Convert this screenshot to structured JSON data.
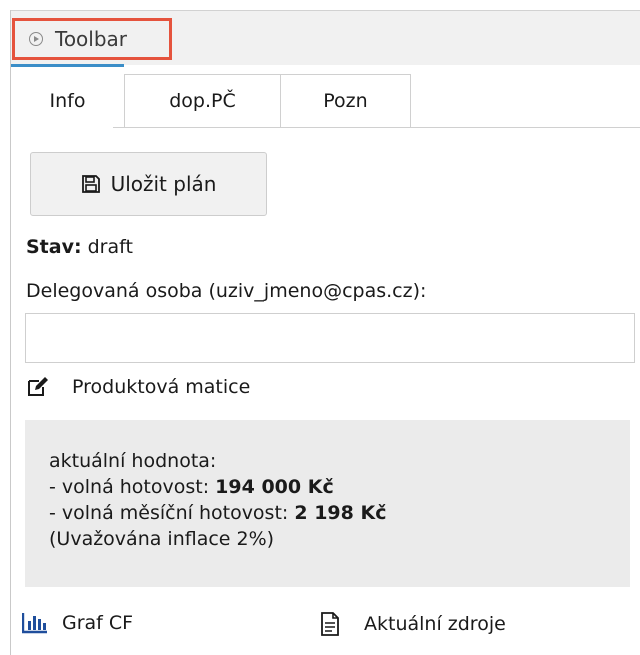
{
  "toolbar": {
    "label": "Toolbar",
    "icon": "play-circle-icon"
  },
  "tabs": [
    {
      "label": "Info",
      "active": true
    },
    {
      "label": "dop.PČ",
      "active": false
    },
    {
      "label": "Pozn",
      "active": false
    }
  ],
  "save_button": {
    "label": "Uložit plán",
    "icon": "floppy-disk-icon"
  },
  "status": {
    "label": "Stav:",
    "value": "draft"
  },
  "delegate": {
    "label": "Delegovaná osoba (uziv_jmeno@cpas.cz):",
    "value": "",
    "placeholder": ""
  },
  "matrix_link": {
    "label": "Produktová matice",
    "icon": "edit-icon"
  },
  "info_box": {
    "heading": "aktuální hodnota:",
    "free_cash_label": "- volná hotovost: ",
    "free_cash_value": "194 000 Kč",
    "monthly_cash_label": "- volná měsíční hotovost: ",
    "monthly_cash_value": "2 198 Kč",
    "inflation_note": "(Uvažována inflace 2%)"
  },
  "bottom_links": {
    "chart": {
      "label": "Graf CF",
      "icon": "bar-chart-icon"
    },
    "sources": {
      "label": "Aktuální zdroje",
      "icon": "document-icon"
    }
  },
  "colors": {
    "highlight": "#e5533d",
    "active_tab": "#3b8ec8",
    "box_bg": "#ebebeb"
  }
}
